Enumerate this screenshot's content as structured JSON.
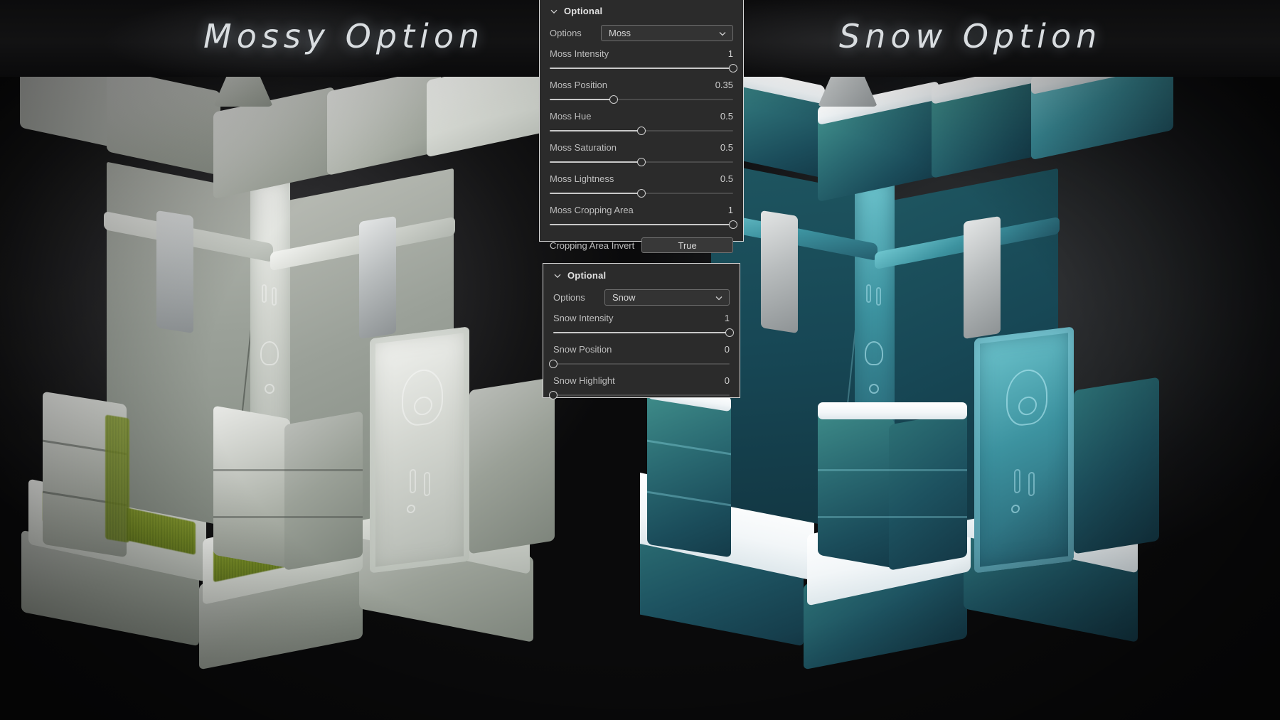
{
  "banner": {
    "left_title": "Mossy Option",
    "right_title": "Snow Option"
  },
  "panels": [
    {
      "name": "moss-panel",
      "header": "Optional",
      "chevron_icon": "chevron-down-icon",
      "options_label": "Options",
      "options_value": "Moss",
      "dropdown_icon": "chevron-down-icon",
      "sliders": [
        {
          "label": "Moss Intensity",
          "value": "1",
          "pct": 100
        },
        {
          "label": "Moss Position",
          "value": "0.35",
          "pct": 35
        },
        {
          "label": "Moss Hue",
          "value": "0.5",
          "pct": 50
        },
        {
          "label": "Moss Saturation",
          "value": "0.5",
          "pct": 50
        },
        {
          "label": "Moss Lightness",
          "value": "0.5",
          "pct": 50
        },
        {
          "label": "Moss Cropping Area",
          "value": "1",
          "pct": 100
        }
      ],
      "toggle_label": "Cropping Area Invert",
      "toggle_value": "True"
    },
    {
      "name": "snow-panel",
      "header": "Optional",
      "chevron_icon": "chevron-down-icon",
      "options_label": "Options",
      "options_value": "Snow",
      "dropdown_icon": "chevron-down-icon",
      "sliders": [
        {
          "label": "Snow Intensity",
          "value": "1",
          "pct": 100
        },
        {
          "label": "Snow Position",
          "value": "0",
          "pct": 0
        },
        {
          "label": "Snow Highlight",
          "value": "0",
          "pct": 0
        }
      ]
    }
  ],
  "colors": {
    "panel_bg": "#2b2b2b",
    "panel_border": "#d7d7d7",
    "label_text": "#bdbdbd",
    "slider_fill": "#c9c9c9",
    "slider_track": "#4a4a4a",
    "moss_green": "#6f8526",
    "snow_white": "#ffffff",
    "ice_teal": "#2a6a72",
    "stone_grey": "#c9ccc6"
  },
  "scene": {
    "left_variant": "moss",
    "right_variant": "snow",
    "subject": "stone tower corner with carved rune pillars and stepped base"
  }
}
